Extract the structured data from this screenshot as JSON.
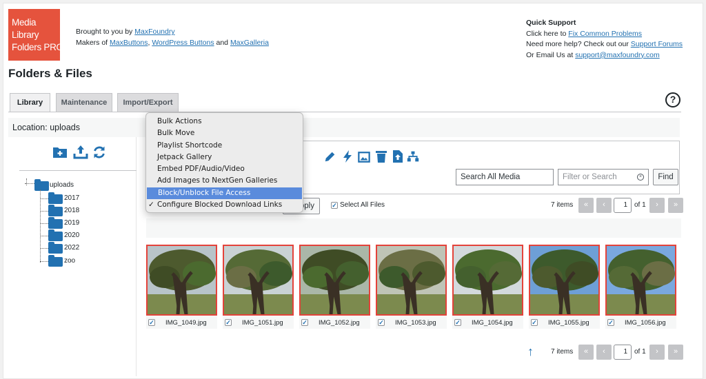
{
  "logo": {
    "lines": [
      "Media",
      "Library",
      "Folders PRO"
    ]
  },
  "header": {
    "brought_prefix": "Brought to you by ",
    "brought_link": "MaxFoundry",
    "makers_prefix": "Makers of ",
    "makers_link1": "MaxButtons",
    "makers_sep": ", ",
    "makers_link2": "WordPress Buttons",
    "makers_and": " and ",
    "makers_link3": "MaxGalleria"
  },
  "support": {
    "title": "Quick Support",
    "line1_prefix": "Click here to ",
    "line1_link": "Fix Common Problems",
    "line2_prefix": "Need more help? Check out our ",
    "line2_link": "Support Forums",
    "line3_prefix": "Or Email Us at ",
    "line3_link": "support@maxfoundry.com"
  },
  "page_title": "Folders & Files",
  "tabs": [
    {
      "label": "Library",
      "active": true
    },
    {
      "label": "Maintenance",
      "active": false
    },
    {
      "label": "Import/Export",
      "active": false
    }
  ],
  "help_label": "?",
  "location": "Location: uploads",
  "tree": {
    "root": "uploads",
    "folders": [
      "2017",
      "2018",
      "2019",
      "2020",
      "2022",
      "zoo"
    ]
  },
  "search": {
    "all_media_label": "Search All Media",
    "filter_placeholder": "Filter or Search",
    "find_label": "Find"
  },
  "bulk": {
    "apply_label": "Apply",
    "select_all_label": "Select All Files"
  },
  "pagination": {
    "items": "7 items",
    "page": "1",
    "of": "of 1",
    "first": "«",
    "prev": "‹",
    "next": "›",
    "last": "»"
  },
  "dropdown_menu": {
    "items": [
      {
        "label": "Bulk Actions",
        "selected": false,
        "highlighted": false
      },
      {
        "label": "Bulk Move",
        "selected": false,
        "highlighted": false
      },
      {
        "label": "Playlist Shortcode",
        "selected": false,
        "highlighted": false
      },
      {
        "label": "Jetpack Gallery",
        "selected": false,
        "highlighted": false
      },
      {
        "label": "Embed PDF/Audio/Video",
        "selected": false,
        "highlighted": false
      },
      {
        "label": "Add Images to NextGen Galleries",
        "selected": false,
        "highlighted": false
      },
      {
        "label": "Block/Unblock File Access",
        "selected": false,
        "highlighted": true
      },
      {
        "label": "Configure Blocked Download Links",
        "selected": true,
        "highlighted": false
      }
    ],
    "check_mark": "✓"
  },
  "files": [
    {
      "name": "IMG_1049.jpg",
      "checked": true
    },
    {
      "name": "IMG_1051.jpg",
      "checked": true
    },
    {
      "name": "IMG_1052.jpg",
      "checked": true
    },
    {
      "name": "IMG_1053.jpg",
      "checked": true
    },
    {
      "name": "IMG_1054.jpg",
      "checked": true
    },
    {
      "name": "IMG_1055.jpg",
      "checked": true
    },
    {
      "name": "IMG_1056.jpg",
      "checked": true
    }
  ],
  "colors": {
    "accent": "#2271b1",
    "logo_bg": "#e5533d",
    "thumb_border": "#e4423a",
    "menu_highlight": "#5a8bdc"
  }
}
